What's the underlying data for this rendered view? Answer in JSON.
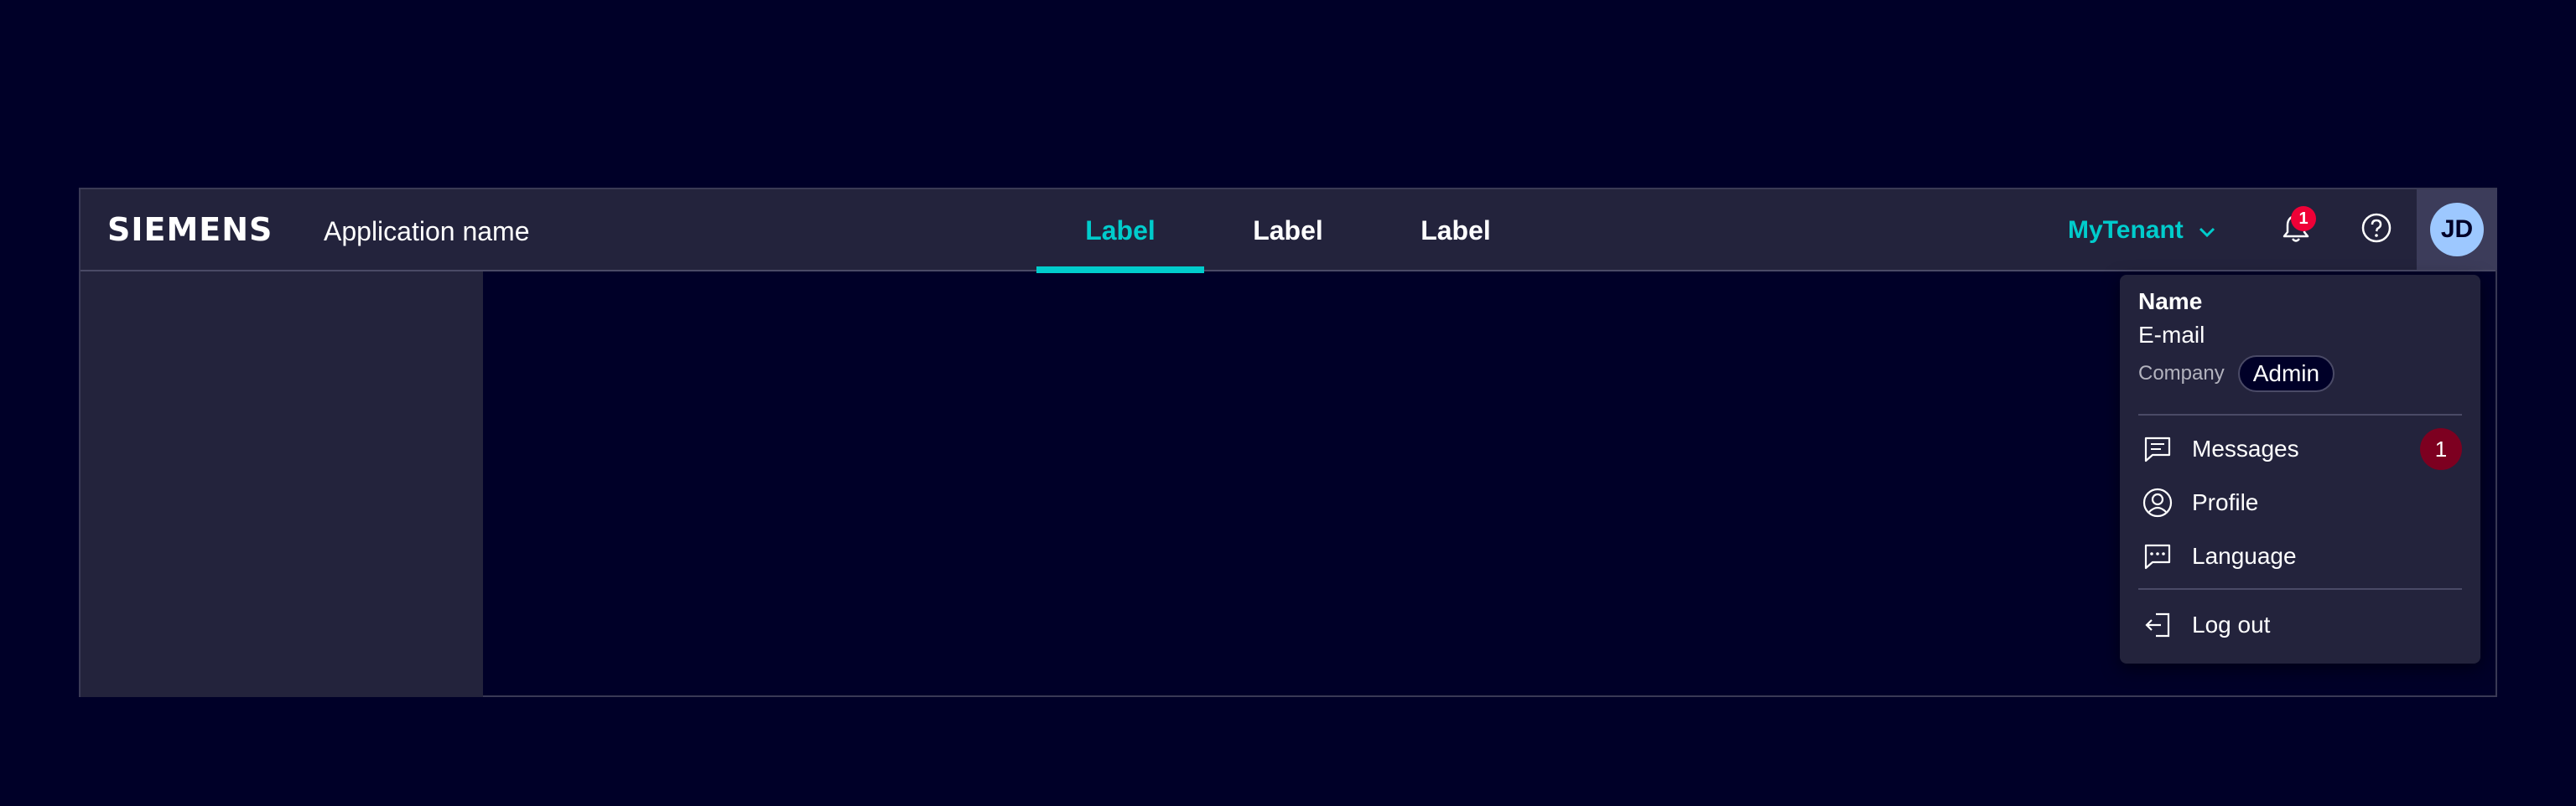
{
  "header": {
    "logo_text": "SIEMENS",
    "app_name": "Application name",
    "tabs": [
      {
        "label": "Label",
        "active": true
      },
      {
        "label": "Label",
        "active": false
      },
      {
        "label": "Label",
        "active": false
      }
    ],
    "tenant": "MyTenant",
    "notification_count": "1",
    "avatar_initials": "JD"
  },
  "user_menu": {
    "name": "Name",
    "email": "E-mail",
    "company": "Company",
    "role": "Admin",
    "items": [
      {
        "label": "Messages",
        "icon": "messages-icon",
        "badge": "1"
      },
      {
        "label": "Profile",
        "icon": "profile-icon"
      },
      {
        "label": "Language",
        "icon": "language-icon"
      }
    ],
    "logout_label": "Log out"
  },
  "colors": {
    "background": "#000028",
    "surface": "#23233c",
    "accent": "#00cccc",
    "notification": "#ef0137",
    "avatar": "#9dc8ff"
  }
}
